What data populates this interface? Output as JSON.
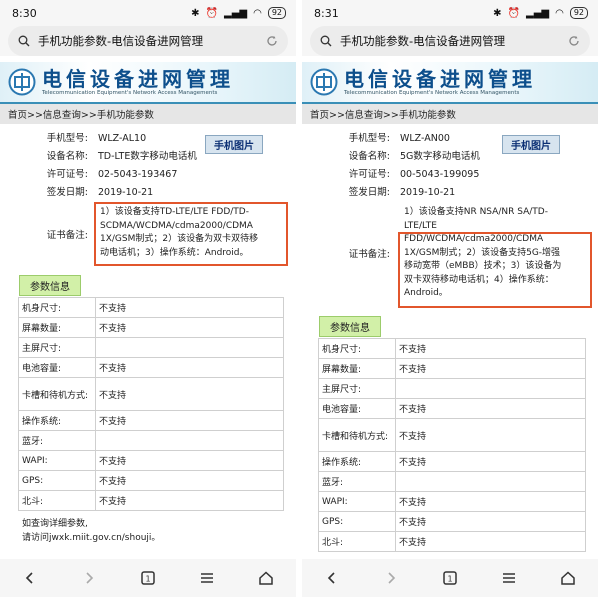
{
  "left": {
    "time": "8:30",
    "battery": "92",
    "url_title": "手机功能参数-电信设备进网管理",
    "site_title": "电信设备进网管理",
    "site_subtitle": "Telecommunication Equipment's Network Access Managements",
    "breadcrumb": "首页>>信息查询>>手机功能参数",
    "model_label": "手机型号:",
    "model": "WLZ-AL10",
    "photo_button": "手机图片",
    "name_label": "设备名称:",
    "name": "TD-LTE数字移动电话机",
    "license_label": "许可证号:",
    "license": "02-5043-193467",
    "date_label": "签发日期:",
    "date": "2019-10-21",
    "cert_label": "证书备注:",
    "cert_lines": [
      "1）该设备支持TD-LTE/LTE FDD/TD-",
      "SCDMA/WCDMA/cdma2000/CDMA",
      "1X/GSM制式；2）该设备为双卡双待移",
      "动电话机；3）操作系统：Android。"
    ],
    "param_header": "参数信息",
    "params": [
      {
        "k": "机身尺寸:",
        "v": "不支持"
      },
      {
        "k": "屏幕数量:",
        "v": "不支持"
      },
      {
        "k": "主屏尺寸:",
        "v": ""
      },
      {
        "k": "电池容量:",
        "v": "不支持"
      },
      {
        "k": "卡槽和待机方式:",
        "v": "不支持"
      },
      {
        "k": "操作系统:",
        "v": "不支持"
      },
      {
        "k": "蓝牙:",
        "v": ""
      },
      {
        "k": "WAPI:",
        "v": "不支持"
      },
      {
        "k": "GPS:",
        "v": "不支持"
      },
      {
        "k": "北斗:",
        "v": "不支持"
      }
    ],
    "footer_line1": "如查询详细参数,",
    "footer_line2": "请访问jwxk.miit.gov.cn/shouji。"
  },
  "right": {
    "time": "8:31",
    "battery": "92",
    "url_title": "手机功能参数-电信设备进网管理",
    "site_title": "电信设备进网管理",
    "site_subtitle": "Telecommunication Equipment's Network Access Managements",
    "breadcrumb": "首页>>信息查询>>手机功能参数",
    "model_label": "手机型号:",
    "model": "WLZ-AN00",
    "photo_button": "手机图片",
    "name_label": "设备名称:",
    "name": "5G数字移动电话机",
    "license_label": "许可证号:",
    "license": "00-5043-199095",
    "date_label": "签发日期:",
    "date": "2019-10-21",
    "cert_label": "证书备注:",
    "cert_lines": [
      "1）该设备支持NR NSA/NR SA/TD-",
      "LTE/LTE",
      "FDD/WCDMA/cdma2000/CDMA",
      "1X/GSM制式；2）该设备支持5G-增强",
      "移动宽带（eMBB）技术；3）该设备为",
      "双卡双待移动电话机；4）操作系统：",
      "Android。"
    ],
    "param_header": "参数信息",
    "params": [
      {
        "k": "机身尺寸:",
        "v": "不支持"
      },
      {
        "k": "屏幕数量:",
        "v": "不支持"
      },
      {
        "k": "主屏尺寸:",
        "v": ""
      },
      {
        "k": "电池容量:",
        "v": "不支持"
      },
      {
        "k": "卡槽和待机方式:",
        "v": "不支持"
      },
      {
        "k": "操作系统:",
        "v": "不支持"
      },
      {
        "k": "蓝牙:",
        "v": ""
      },
      {
        "k": "WAPI:",
        "v": "不支持"
      },
      {
        "k": "GPS:",
        "v": "不支持"
      },
      {
        "k": "北斗:",
        "v": "不支持"
      }
    ]
  },
  "icons": [
    "bluetooth-icon",
    "alarm-icon",
    "signal-icon",
    "wifi-icon",
    "battery-icon",
    "search-icon",
    "reload-icon",
    "back-icon",
    "forward-icon",
    "tabs-icon",
    "menu-icon",
    "home-icon"
  ],
  "colors": {
    "highlight_box": "#e2562c",
    "param_header_bg": "#d2f0a8",
    "site_title": "#0d4f8c"
  }
}
